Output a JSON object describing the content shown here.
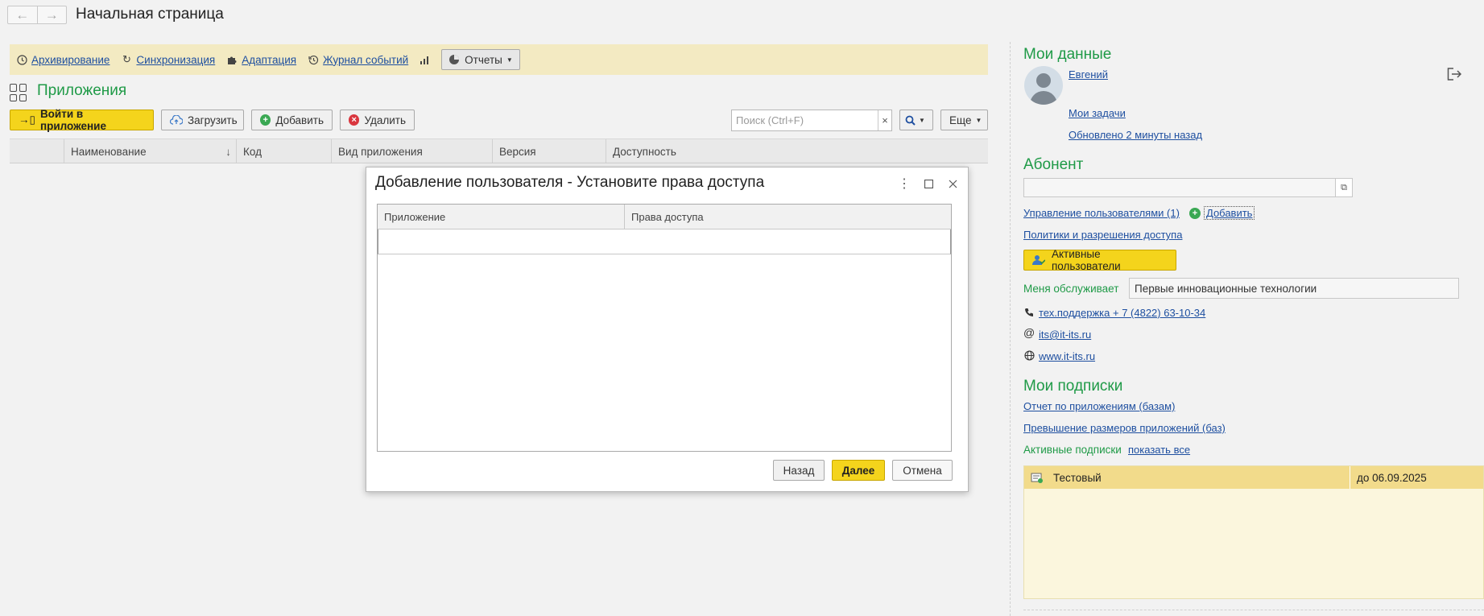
{
  "window": {
    "title": "Начальная страница"
  },
  "nav": {
    "back_icon": "arrow-left-icon",
    "forward_icon": "arrow-right-icon"
  },
  "command_bar": {
    "archive": "Архивирование",
    "sync": "Синхронизация",
    "adaptation": "Адаптация",
    "event_log": "Журнал событий",
    "reports": "Отчеты"
  },
  "apps": {
    "title": "Приложения",
    "enter_button": "Войти в приложение",
    "upload_button": "Загрузить",
    "add_button": "Добавить",
    "delete_button": "Удалить",
    "search_placeholder": "Поиск (Ctrl+F)",
    "search_clear": "×",
    "more_button": "Еще",
    "columns": [
      "Наименование",
      "Код",
      "Вид приложения",
      "Версия",
      "Доступность"
    ],
    "sort_indicator": "↓"
  },
  "dialog": {
    "title": "Добавление пользователя - Установите права доступа",
    "columns": [
      "Приложение",
      "Права доступа"
    ],
    "back_button": "Назад",
    "next_button": "Далее",
    "cancel_button": "Отмена"
  },
  "my_data": {
    "title": "Мои данные",
    "user_name": "Евгений",
    "my_tasks": "Мои задачи",
    "updated": "Обновлено 2 минуты назад"
  },
  "subscriber": {
    "title": "Абонент",
    "manage_users": "Управление пользователями (1)",
    "add": "Добавить",
    "policies": "Политики и разрешения доступа",
    "active_users_button": "Активные пользователи",
    "serviced_by_label": "Меня обслуживает",
    "serviced_by_value": "Первые инновационные технологии",
    "support_phone": "тех.поддержка + 7 (4822) 63-10-34",
    "email": "its@it-its.ru",
    "website": "www.it-its.ru"
  },
  "subscriptions": {
    "title": "Мои подписки",
    "apps_report": "Отчет по приложениям (базам)",
    "size_exceed": "Превышение размеров приложений (баз)",
    "active_label": "Активные подписки",
    "show_all": "показать все",
    "rows": [
      {
        "name": "Тестовый",
        "until": "до 06.09.2025"
      }
    ]
  },
  "colors": {
    "accent_green": "#1f9a47",
    "button_yellow": "#f4d41c",
    "command_bar_bg": "#f3eac2",
    "link_blue": "#1e4fa0"
  }
}
